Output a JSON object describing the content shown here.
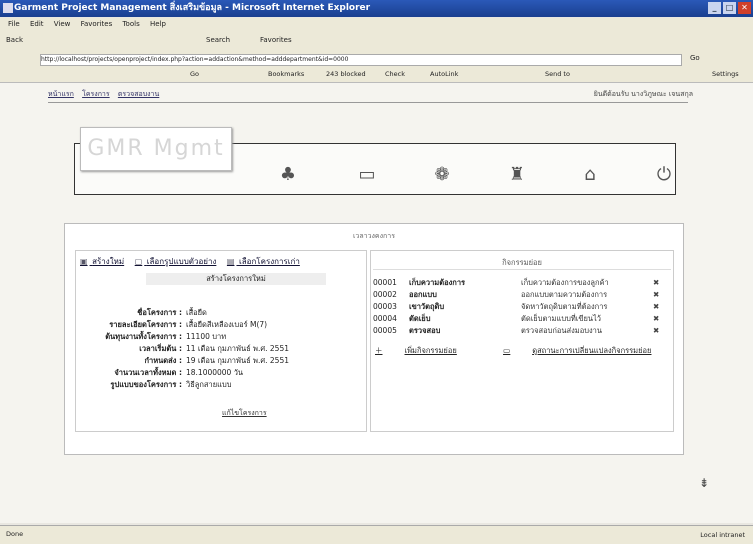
{
  "window": {
    "title": "Garment Project Management สิ่งเสริมข้อมูล - Microsoft Internet Explorer",
    "buttons": [
      "_",
      "□",
      "✕"
    ]
  },
  "menu": [
    "File",
    "Edit",
    "View",
    "Favorites",
    "Tools",
    "Help"
  ],
  "toolbar": {
    "back": "Back",
    "search": "Search",
    "favorites": "Favorites"
  },
  "address": {
    "url": "http://localhost/projects/openproject/index.php?action=addaction&method=adddepartment&id=0000",
    "go": "Go"
  },
  "links": {
    "go": "Go",
    "bookmarks": "Bookmarks",
    "blocked": "243 blocked",
    "check": "Check",
    "autolink": "AutoLink",
    "sendto": "Send to",
    "settings": "Settings"
  },
  "breadcrumbs": [
    "หน้าแรก",
    "โครงการ",
    "ตรวจสอบงาน"
  ],
  "welcome": "ยินดีต้อนรับ นางวิภูษณะ เจนสกุล",
  "logo": "GMR Mgmt",
  "panel": {
    "title": "เวลาวงคงการ",
    "tabs": [
      {
        "label": "สร้างใหม่",
        "icon": "▣"
      },
      {
        "label": "เลือกรูปแบบตัวอย่าง",
        "icon": "▢"
      },
      {
        "label": "เลือกโครงการเก่า",
        "icon": "▤"
      }
    ],
    "subheader": "สร้างโครงการใหม่",
    "form": [
      {
        "label": "ชื่อโครงการ :",
        "value": "เสื้อยืด"
      },
      {
        "label": "รายละเอียดโครงการ :",
        "value": "เสื้อยืดสีเหลืองเบอร์ M(7)"
      },
      {
        "label": "ต้นทุนงานทั้งโครงการ :",
        "value": "11100 บาท"
      },
      {
        "label": "เวลาเริ่มต้น :",
        "value": "11 เดือน กุมภาพันธ์ พ.ศ. 2551"
      },
      {
        "label": "กำหนดส่ง :",
        "value": "19 เดือน กุมภาพันธ์ พ.ศ. 2551"
      },
      {
        "label": "จำนวนเวลาทั้งหมด :",
        "value": "18.1000000 วัน"
      },
      {
        "label": "รูปแบบของโครงการ :",
        "value": "วิธีลูกสายแบบ"
      }
    ],
    "edit_link": "แก้ไขโครงการ",
    "activity_header": "กิจกรรมย่อย",
    "activities": [
      {
        "code": "00001",
        "name": "เก็บความต้องการ",
        "desc": "เก็บความต้องการของลูกค้า",
        "del": "✖"
      },
      {
        "code": "00002",
        "name": "ออกแบบ",
        "desc": "ออกแบบตามความต้องการ",
        "del": "✖"
      },
      {
        "code": "00003",
        "name": "เขาวัตถุดิบ",
        "desc": "จัดหาวัตถุดิบตามที่ต้องการ",
        "del": "✖"
      },
      {
        "code": "00004",
        "name": "ตัดเย็บ",
        "desc": "ตัดเย็บตามแบบที่เขียนไว้",
        "del": "✖"
      },
      {
        "code": "00005",
        "name": "ตรวจสอบ",
        "desc": "ตรวจสอบก่อนส่งมอบงาน",
        "del": "✖"
      }
    ],
    "add_activity": "เพิ่มกิจกรรมย่อย",
    "view_changes": "ดูสถานะการเปลี่ยนแปลงกิจกรรมย่อย"
  },
  "nav_icons": [
    "house-icon",
    "document-icon",
    "palette-icon",
    "settings-icon",
    "user-icon",
    "power-icon"
  ],
  "status": {
    "left": "Done",
    "right": "Local intranet"
  }
}
